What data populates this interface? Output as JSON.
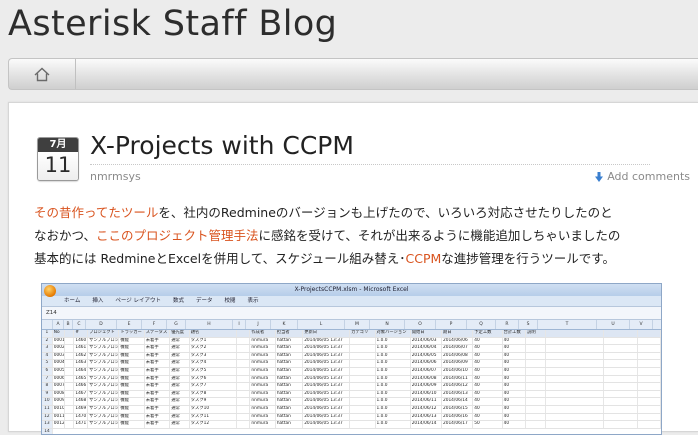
{
  "site": {
    "title": "Asterisk Staff Blog"
  },
  "nav": {
    "home_icon": "home-icon"
  },
  "post": {
    "date_month": "7月",
    "date_day": "11",
    "title": "X-Projects with CCPM",
    "author": "nmrmsys",
    "add_comments": "Add comments",
    "para": [
      {
        "link1": "その昔作ってたツール",
        "text1": "を、社内のRedmineのバージョンも上げたので、いろいろ対応させたりしたのと"
      },
      {
        "text0": "なおかつ、",
        "link1": "ここのプロジェクト管理手法",
        "text1": "に感銘を受けて、それが出来るように機能追加しちゃいましたの"
      },
      {
        "text0": "基本的には RedmineとExcelを併用して、スケジュール組み替え･",
        "link1": "CCPM",
        "text1": "な進捗管理を行うツールです。"
      }
    ]
  },
  "screenshot": {
    "window_title": "X-ProjectsCCPM.xlsm - Microsoft Excel",
    "ribbon_tabs": [
      "ホーム",
      "挿入",
      "ページ レイアウト",
      "数式",
      "データ",
      "校閲",
      "表示"
    ],
    "name_box": "Z14",
    "col_letters": [
      "A",
      "B",
      "C",
      "D",
      "E",
      "F",
      "G",
      "H",
      "I",
      "J",
      "K",
      "L",
      "M",
      "N",
      "O",
      "P",
      "Q",
      "R",
      "S",
      "T",
      "U",
      "V"
    ],
    "header_row": [
      "No",
      "",
      "#",
      "プロジェクト",
      "トラッカー",
      "ステータス",
      "優先度",
      "題名",
      "",
      "作成者",
      "担当者",
      "更新日",
      "カテゴリ",
      "対象バージョン",
      "開始日",
      "期日",
      "予定工数",
      "合計工数",
      "説明",
      "",
      "",
      ""
    ],
    "rows": [
      [
        "0001",
        "",
        "1460",
        "サンプルプロジェ",
        "機能",
        "未着手",
        "通常",
        "タスク1",
        "",
        "nnmura",
        "hattan",
        "2014/06/05 13:37",
        "",
        "1.0.0",
        "2014/06/03",
        "2014/06/06",
        "40",
        "40",
        "",
        "",
        "",
        ""
      ],
      [
        "0002",
        "",
        "1461",
        "サンプルプロジェ",
        "機能",
        "未着手",
        "通常",
        "タスク2",
        "",
        "nnmura",
        "hattan",
        "2014/06/05 13:37",
        "",
        "1.0.0",
        "2014/06/04",
        "2014/06/07",
        "40",
        "40",
        "",
        "",
        "",
        ""
      ],
      [
        "0003",
        "",
        "1462",
        "サンプルプロジェ",
        "機能",
        "未着手",
        "通常",
        "タスク3",
        "",
        "nnmura",
        "hattan",
        "2014/06/05 13:37",
        "",
        "1.0.0",
        "2014/06/05",
        "2014/06/08",
        "40",
        "40",
        "",
        "",
        "",
        ""
      ],
      [
        "0004",
        "",
        "1463",
        "サンプルプロジェ",
        "機能",
        "未着手",
        "通常",
        "タスク4",
        "",
        "nnmura",
        "hattan",
        "2014/06/05 13:37",
        "",
        "1.0.0",
        "2014/06/06",
        "2014/06/09",
        "40",
        "40",
        "",
        "",
        "",
        ""
      ],
      [
        "0005",
        "",
        "1464",
        "サンプルプロジェ",
        "機能",
        "未着手",
        "通常",
        "タスク5",
        "",
        "nnmura",
        "hattan",
        "2014/06/05 13:37",
        "",
        "1.0.0",
        "2014/06/07",
        "2014/06/10",
        "40",
        "40",
        "",
        "",
        "",
        ""
      ],
      [
        "0006",
        "",
        "1465",
        "サンプルプロジェ",
        "機能",
        "未着手",
        "通常",
        "タスク6",
        "",
        "nnmura",
        "hattan",
        "2014/06/05 13:37",
        "",
        "1.0.0",
        "2014/06/08",
        "2014/06/11",
        "40",
        "40",
        "",
        "",
        "",
        ""
      ],
      [
        "0007",
        "",
        "1466",
        "サンプルプロジェ",
        "機能",
        "未着手",
        "通常",
        "タスク7",
        "",
        "nnmura",
        "hattan",
        "2014/06/05 13:37",
        "",
        "1.0.0",
        "2014/06/09",
        "2014/06/12",
        "40",
        "40",
        "",
        "",
        "",
        ""
      ],
      [
        "0008",
        "",
        "1467",
        "サンプルプロジェ",
        "機能",
        "未着手",
        "通常",
        "タスク8",
        "",
        "nnmura",
        "hattan",
        "2014/06/05 13:37",
        "",
        "1.0.0",
        "2014/06/10",
        "2014/06/13",
        "40",
        "40",
        "",
        "",
        "",
        ""
      ],
      [
        "0009",
        "",
        "1468",
        "サンプルプロジェ",
        "機能",
        "未着手",
        "通常",
        "タスク9",
        "",
        "nnmura",
        "hattan",
        "2014/06/05 13:37",
        "",
        "1.0.0",
        "2014/06/11",
        "2014/06/14",
        "40",
        "40",
        "",
        "",
        "",
        ""
      ],
      [
        "0010",
        "",
        "1469",
        "サンプルプロジェ",
        "機能",
        "未着手",
        "通常",
        "タスク10",
        "",
        "nnmura",
        "hattan",
        "2014/06/05 13:37",
        "",
        "1.0.0",
        "2014/06/12",
        "2014/06/15",
        "40",
        "40",
        "",
        "",
        "",
        ""
      ],
      [
        "0011",
        "",
        "1470",
        "サンプルプロジェ",
        "機能",
        "未着手",
        "通常",
        "タスク11",
        "",
        "nnmura",
        "hattan",
        "2014/06/05 13:37",
        "",
        "1.0.0",
        "2014/06/13",
        "2014/06/16",
        "40",
        "40",
        "",
        "",
        "",
        ""
      ],
      [
        "0012",
        "",
        "1471",
        "サンプルプロジェ",
        "機能",
        "未着手",
        "通常",
        "タスク12",
        "",
        "nnmura",
        "hattan",
        "2014/06/05 13:37",
        "",
        "1.0.0",
        "2014/06/14",
        "2014/06/17",
        "50",
        "40",
        "",
        "",
        "",
        ""
      ]
    ]
  },
  "colors": {
    "link": "#d9531e",
    "text": "#222222",
    "meta": "#8a8a8a"
  }
}
